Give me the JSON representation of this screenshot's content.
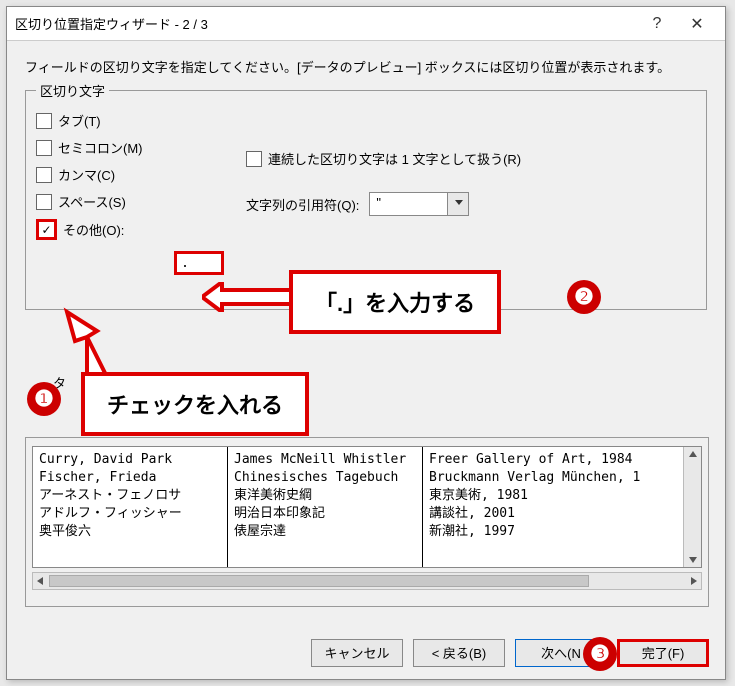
{
  "titlebar": {
    "title": "区切り位置指定ウィザード - 2 / 3",
    "help_icon": "?",
    "close_icon": "✕"
  },
  "instruction": "フィールドの区切り文字を指定してください。[データのプレビュー] ボックスには区切り位置が表示されます。",
  "delimiters": {
    "legend": "区切り文字",
    "tab": "タブ(T)",
    "semicolon": "セミコロン(M)",
    "comma": "カンマ(C)",
    "space": "スペース(S)",
    "other": "その他(O):",
    "other_value": ".",
    "consecutive": "連続した区切り文字は 1 文字として扱う(R)",
    "qualifier_label": "文字列の引用符(Q):",
    "qualifier_value": "\""
  },
  "preview": {
    "label_stub": "タ",
    "col1": [
      "Curry, David Park",
      "Fischer, Frieda",
      "アーネスト・フェノロサ",
      "アドルフ・フィッシャー",
      "奥平俊六"
    ],
    "col2": [
      "James McNeill Whistler",
      "Chinesisches Tagebuch",
      "東洋美術史綱",
      "明治日本印象記",
      "俵屋宗達"
    ],
    "col3": [
      "Freer Gallery of Art, 1984",
      "Bruckmann Verlag München, 1",
      "東京美術, 1981",
      "講談社, 2001",
      "新潮社, 1997"
    ]
  },
  "buttons": {
    "cancel": "キャンセル",
    "back": "< 戻る(B)",
    "next": "次へ(N",
    "finish": "完了(F)"
  },
  "callouts": {
    "c1": "チェックを入れる",
    "c2": "「.」を入力する"
  },
  "badges": {
    "b1": "❶",
    "b2": "❷",
    "b3": "❸"
  }
}
